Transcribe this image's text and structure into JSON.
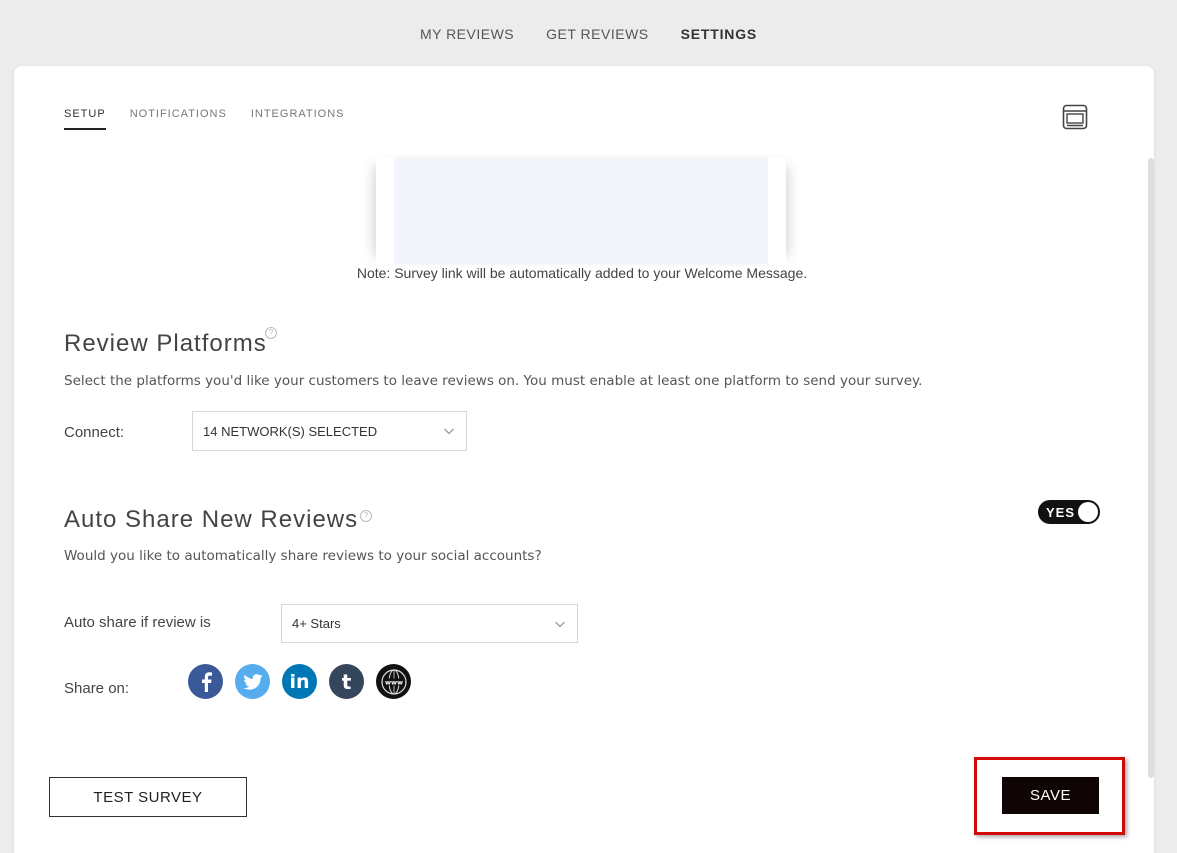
{
  "topnav": {
    "items": [
      {
        "label": "MY REVIEWS",
        "active": false
      },
      {
        "label": "GET REVIEWS",
        "active": false
      },
      {
        "label": "SETTINGS",
        "active": true
      }
    ]
  },
  "subtabs": [
    {
      "label": "SETUP",
      "active": true
    },
    {
      "label": "NOTIFICATIONS",
      "active": false
    },
    {
      "label": "INTEGRATIONS",
      "active": false
    }
  ],
  "preview": {
    "note": "Note: Survey link will be automatically added to your Welcome Message."
  },
  "review_platforms": {
    "title": "Review Platforms",
    "description": "Select the platforms you'd like your customers to leave reviews on. You must enable at least one platform to send your survey.",
    "connect_label": "Connect:",
    "connect_value": "14 NETWORK(S) SELECTED"
  },
  "auto_share": {
    "title": "Auto Share New Reviews",
    "description": "Would you like to automatically share reviews to your social accounts?",
    "toggle_label": "YES",
    "rule_label": "Auto share if review is",
    "rule_value": "4+ Stars",
    "share_on_label": "Share on:",
    "networks": [
      {
        "name": "facebook",
        "glyph": "f",
        "color": "#3b5998"
      },
      {
        "name": "twitter",
        "glyph": "🐦",
        "color": "#55acee"
      },
      {
        "name": "linkedin",
        "glyph": "in",
        "color": "#0077b5"
      },
      {
        "name": "tumblr",
        "glyph": "t",
        "color": "#35465c"
      },
      {
        "name": "website",
        "glyph": "www",
        "color": "#111111"
      }
    ]
  },
  "actions": {
    "test_label": "TEST SURVEY",
    "save_label": "SAVE"
  }
}
